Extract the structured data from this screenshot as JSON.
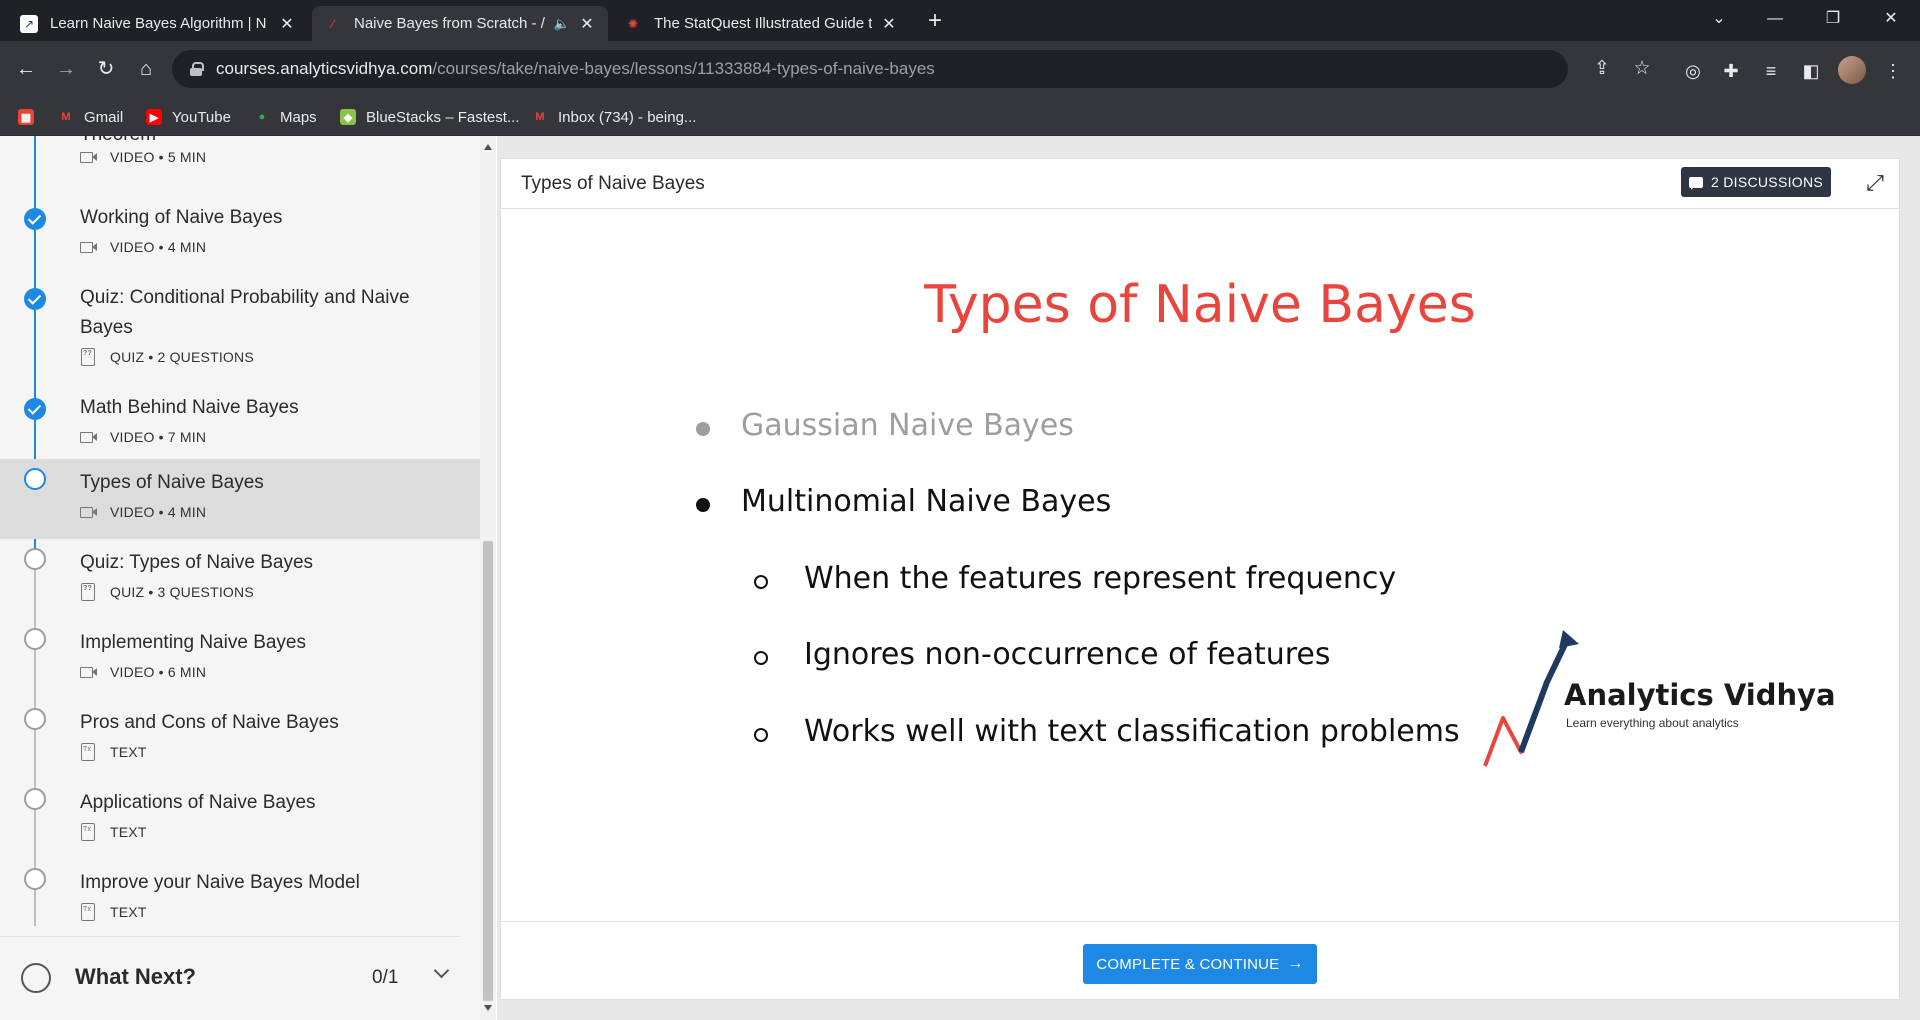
{
  "browser": {
    "tabs": [
      {
        "title": "Learn Naive Bayes Algorithm | N",
        "close": "✕"
      },
      {
        "title": "Naive Bayes from Scratch - /",
        "close": "✕"
      },
      {
        "title": "The StatQuest Illustrated Guide t",
        "close": "✕"
      }
    ],
    "new_tab": "+",
    "url_domain": "courses.analyticsvidhya.com",
    "url_path": "/courses/take/naive-bayes/lessons/11333884-types-of-naive-bayes",
    "bookmarks": [
      {
        "label": "Gmail",
        "icon": "gmail-icon",
        "color": "#ea4335"
      },
      {
        "label": "YouTube",
        "icon": "youtube-icon",
        "color": "#ff0000"
      },
      {
        "label": "Maps",
        "icon": "maps-icon",
        "color": "#34a853"
      },
      {
        "label": "BlueStacks – Fastest...",
        "icon": "bluestacks-icon",
        "color": "#8bc34a"
      },
      {
        "label": "Inbox (734) - being...",
        "icon": "gmail-icon",
        "color": "#ea4335"
      }
    ]
  },
  "sidebar": {
    "partial_item": {
      "title": "Theorem",
      "meta": "VIDEO • 5 MIN"
    },
    "lessons": [
      {
        "title": "Working of Naive Bayes",
        "meta": "VIDEO • 4 MIN",
        "type": "video",
        "status": "done"
      },
      {
        "title": "Quiz: Conditional Probability and Naive Bayes",
        "meta": "QUIZ • 2 QUESTIONS",
        "type": "quiz",
        "status": "done"
      },
      {
        "title": "Math Behind Naive Bayes",
        "meta": "VIDEO • 7 MIN",
        "type": "video",
        "status": "done"
      },
      {
        "title": "Types of Naive Bayes",
        "meta": "VIDEO • 4 MIN",
        "type": "video",
        "status": "current"
      },
      {
        "title": "Quiz: Types of Naive Bayes",
        "meta": "QUIZ • 3 QUESTIONS",
        "type": "quiz",
        "status": "todo"
      },
      {
        "title": "Implementing Naive Bayes",
        "meta": "VIDEO • 6 MIN",
        "type": "video",
        "status": "todo"
      },
      {
        "title": "Pros and Cons of Naive Bayes",
        "meta": "TEXT",
        "type": "text",
        "status": "todo"
      },
      {
        "title": "Applications of Naive Bayes",
        "meta": "TEXT",
        "type": "text",
        "status": "todo"
      },
      {
        "title": "Improve your Naive Bayes Model",
        "meta": "TEXT",
        "type": "text",
        "status": "todo"
      }
    ],
    "what_next": {
      "label": "What Next?",
      "count": "0/1"
    }
  },
  "main": {
    "header_title": "Types of Naive Bayes",
    "discussions_label": "2 DISCUSSIONS",
    "slide": {
      "title": "Types of Naive Bayes",
      "bullets": [
        {
          "text": "Gaussian Naive Bayes",
          "level": 1,
          "dim": true
        },
        {
          "text": "Multinomial Naive Bayes",
          "level": 1,
          "dim": false
        },
        {
          "text": "When the features represent frequency",
          "level": 2
        },
        {
          "text": "Ignores non-occurrence of features",
          "level": 2
        },
        {
          "text": "Works well with text classification problems",
          "level": 2
        }
      ],
      "logo_name": "Analytics Vidhya",
      "logo_tagline": "Learn everything about analytics"
    },
    "complete_button": "COMPLETE & CONTINUE",
    "complete_arrow": "→"
  },
  "colors": {
    "accent": "#1e88e5",
    "slide_title": "#e8453c",
    "discussions_bg": "#2f3542"
  }
}
